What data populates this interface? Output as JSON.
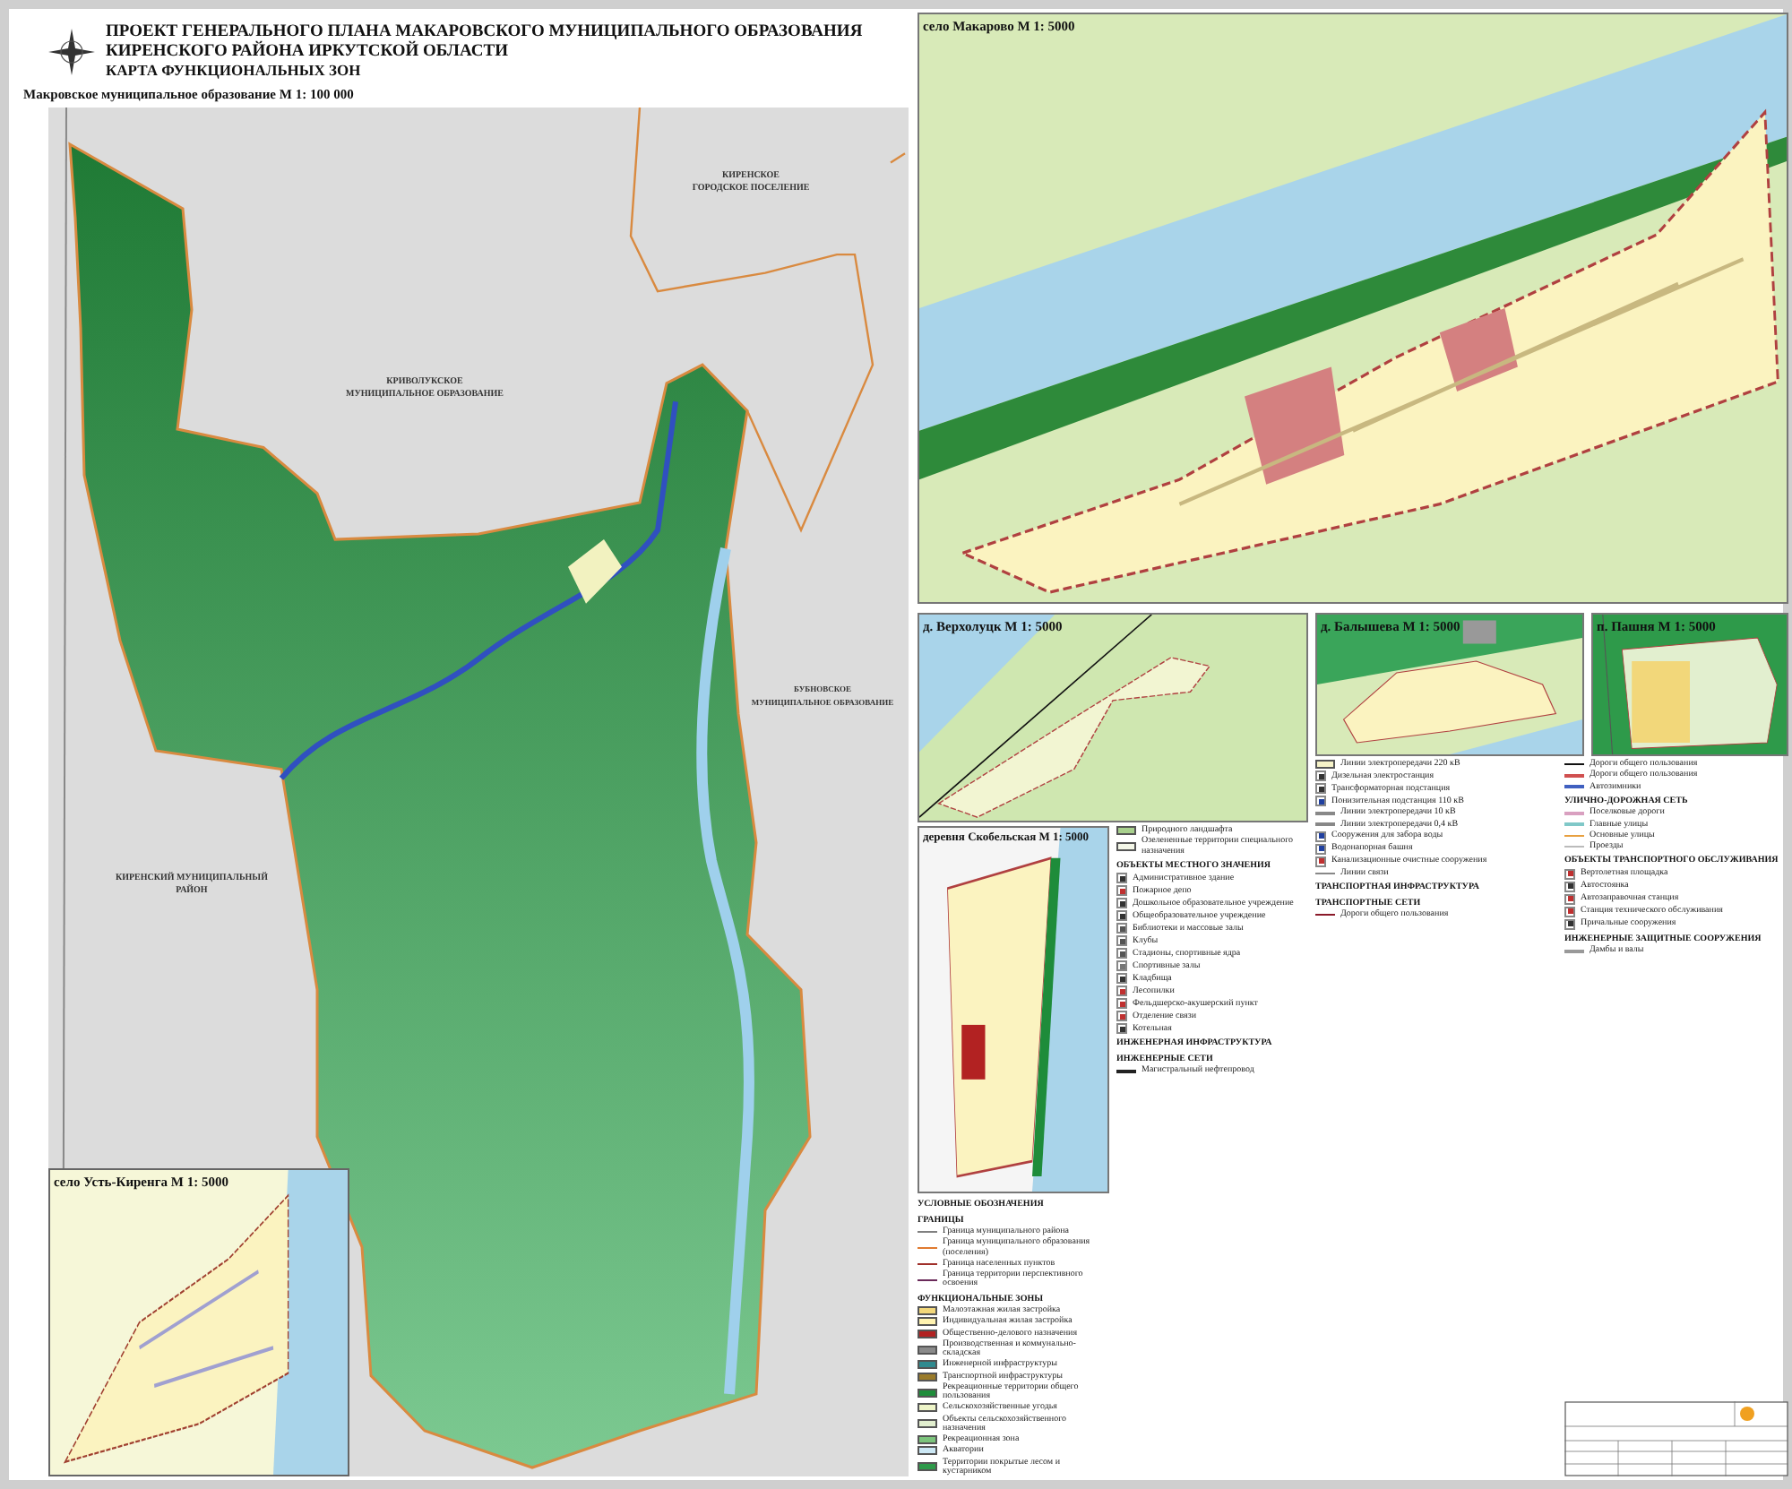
{
  "title": {
    "lines": [
      "ПРОЕКТ ГЕНЕРАЛЬНОГО ПЛАНА МАКАРОВСКОГО МУНИЦИПАЛЬНОГО ОБРАЗОВАНИЯ",
      "КИРЕНСКОГО РАЙОНА ИРКУТСКОЙ ОБЛАСТИ",
      "КАРТА ФУНКЦИОНАЛЬНЫХ ЗОН"
    ]
  },
  "main_map": {
    "caption": "Макровское муниципальное образование М 1: 100 000",
    "labels": [
      {
        "lines": [
          "КИРЕНСКОЕ",
          "ГОРОДСКОЕ ПОСЕЛЕНИЕ"
        ]
      },
      {
        "lines": [
          "КРИВОЛУКСКОЕ",
          "МУНИЦИПАЛЬНОЕ ОБРАЗОВАНИЕ"
        ]
      },
      {
        "lines": [
          "БУБНОВСКОЕ",
          "МУНИЦИПАЛЬНОЕ ОБРАЗОВАНИЕ"
        ]
      },
      {
        "lines": [
          "КИРЕНСКИЙ МУНИЦИПАЛЬНЫЙ",
          "РАЙОН"
        ]
      }
    ]
  },
  "insets": [
    {
      "caption": "село Макарово М 1: 5000"
    },
    {
      "caption": "д. Верхолуцк М 1: 5000"
    },
    {
      "caption": "д. Балышева М 1: 5000"
    },
    {
      "caption": "п. Пашня М 1: 5000"
    },
    {
      "caption": "деревня Скобельская М 1: 5000"
    },
    {
      "caption": "село Усть-Киренга М 1: 5000"
    }
  ],
  "legend": {
    "columns": [
      [
        {
          "kind": "heading",
          "label": "УСЛОВНЫЕ ОБОЗНАЧЕНИЯ"
        },
        {
          "kind": "heading",
          "label": "ГРАНИЦЫ"
        },
        {
          "kind": "line",
          "label": "Граница муниципального района",
          "color": "#808080"
        },
        {
          "kind": "line",
          "label": "Граница муниципального образования (поселения)",
          "color": "#e07a30"
        },
        {
          "kind": "line",
          "label": "Граница населенных пунктов",
          "color": "#a0302a"
        },
        {
          "kind": "line",
          "label": "Граница территории перспективного освоения",
          "color": "#6a2a5a"
        },
        {
          "kind": "heading",
          "label": "ФУНКЦИОНАЛЬНЫЕ ЗОНЫ"
        },
        {
          "kind": "fill",
          "label": "Малоэтажная жилая застройка",
          "color": "#f2d77a"
        },
        {
          "kind": "fill",
          "label": "Индивидуальная жилая застройка",
          "color": "#fff3b0"
        },
        {
          "kind": "fill",
          "label": "Общественно-делового назначения",
          "color": "#b22222"
        },
        {
          "kind": "fill",
          "label": "Производственная и коммунально-складская",
          "color": "#8a8a8a"
        },
        {
          "kind": "fill",
          "label": "Инженерной инфраструктуры",
          "color": "#2f8a8f"
        },
        {
          "kind": "fill",
          "label": "Транспортной инфраструктуры",
          "color": "#9a7b2a"
        },
        {
          "kind": "fill",
          "label": "Рекреационные территории общего пользования",
          "color": "#1e8c3a"
        },
        {
          "kind": "fill",
          "label": "Сельскохозяйственные угодья",
          "color": "#eef5c8"
        },
        {
          "kind": "fill",
          "label": "Объекты сельскохозяйственного назначения",
          "color": "#e2efcf"
        },
        {
          "kind": "fill",
          "label": "Рекреационная зона",
          "color": "#7cc47c"
        },
        {
          "kind": "fill",
          "label": "Акватории",
          "color": "#cce8f5"
        },
        {
          "kind": "fill",
          "label": "Территории покрытые лесом и кустарником",
          "color": "#2e9a4a"
        }
      ],
      [
        {
          "kind": "fill",
          "label": "Природного ландшафта",
          "color": "#a8d08d"
        },
        {
          "kind": "fill",
          "label": "Озелененные территории специального назначения",
          "color": "#f4f7e8"
        },
        {
          "kind": "heading",
          "label": "ОБЪЕКТЫ МЕСТНОГО ЗНАЧЕНИЯ"
        },
        {
          "kind": "symbol",
          "label": "Административное здание",
          "color": "#333333"
        },
        {
          "kind": "symbol",
          "label": "Пожарное депо",
          "color": "#c03030"
        },
        {
          "kind": "symbol",
          "label": "Дошкольное образовательное учреждение",
          "color": "#333333"
        },
        {
          "kind": "symbol",
          "label": "Общеобразовательное учреждение",
          "color": "#333333"
        },
        {
          "kind": "symbol",
          "label": "Библиотеки и массовые залы",
          "color": "#555555"
        },
        {
          "kind": "symbol",
          "label": "Клубы",
          "color": "#555555"
        },
        {
          "kind": "symbol",
          "label": "Стадионы, спортивные ядра",
          "color": "#555555"
        },
        {
          "kind": "symbol",
          "label": "Спортивные залы",
          "color": "#777777"
        },
        {
          "kind": "symbol",
          "label": "Кладбища",
          "color": "#333333"
        },
        {
          "kind": "symbol",
          "label": "Лесопилки",
          "color": "#c03030"
        },
        {
          "kind": "symbol",
          "label": "Фельдшерско-акушерский пункт",
          "color": "#c03030"
        },
        {
          "kind": "symbol",
          "label": "Отделение связи",
          "color": "#c03030"
        },
        {
          "kind": "symbol",
          "label": "Котельная",
          "color": "#333333"
        },
        {
          "kind": "heading",
          "label": "ИНЖЕНЕРНАЯ ИНФРАСТРУКТУРА"
        },
        {
          "kind": "heading",
          "label": "ИНЖЕНЕРНЫЕ СЕТИ"
        },
        {
          "kind": "line",
          "label": "Магистральный нефтепровод",
          "color": "#222222"
        }
      ],
      [
        {
          "kind": "fill",
          "label": "Линии электропередачи 220 кВ",
          "color": "#f6f3c8"
        },
        {
          "kind": "symbol",
          "label": "Дизельная электростанция",
          "color": "#333333"
        },
        {
          "kind": "symbol",
          "label": "Трансформаторная подстанция",
          "color": "#333333"
        },
        {
          "kind": "symbol",
          "label": "Понизительная подстанция 110 кВ",
          "color": "#2040a0"
        },
        {
          "kind": "line",
          "label": "Линии электропередачи 10 кВ",
          "color": "#888888"
        },
        {
          "kind": "line",
          "label": "Линии электропередачи 0,4 кВ",
          "color": "#888888"
        },
        {
          "kind": "symbol",
          "label": "Сооружения для забора воды",
          "color": "#2040a0"
        },
        {
          "kind": "symbol",
          "label": "Водонапорная башня",
          "color": "#2040a0"
        },
        {
          "kind": "symbol",
          "label": "Канализационные очистные сооружения",
          "color": "#c03030"
        },
        {
          "kind": "line",
          "label": "Линии связи",
          "color": "#888888"
        },
        {
          "kind": "heading",
          "label": "ТРАНСПОРТНАЯ ИНФРАСТРУКТУРА"
        },
        {
          "kind": "heading",
          "label": "ТРАНСПОРТНЫЕ СЕТИ"
        },
        {
          "kind": "line",
          "label": "Дороги общего пользования",
          "color": "#8a1a2a"
        }
      ],
      [
        {
          "kind": "line",
          "label": "Дороги общего пользования",
          "color": "#111111"
        },
        {
          "kind": "line",
          "label": "Дороги общего пользования",
          "color": "#d05050"
        },
        {
          "kind": "line",
          "label": "Автозимники",
          "color": "#4060c0"
        },
        {
          "kind": "heading",
          "label": "УЛИЧНО-ДОРОЖНАЯ СЕТЬ"
        },
        {
          "kind": "line",
          "label": "Поселковые дороги",
          "color": "#d9a0c0"
        },
        {
          "kind": "line",
          "label": "Главные улицы",
          "color": "#80c8c8"
        },
        {
          "kind": "line",
          "label": "Основные улицы",
          "color": "#e8a040"
        },
        {
          "kind": "line",
          "label": "Проезды",
          "color": "#bbbbbb"
        },
        {
          "kind": "heading",
          "label": "ОБЪЕКТЫ ТРАНСПОРТНОГО ОБСЛУЖИВАНИЯ"
        },
        {
          "kind": "symbol",
          "label": "Вертолетная площадка",
          "color": "#c03030"
        },
        {
          "kind": "symbol",
          "label": "Автостоянка",
          "color": "#333333"
        },
        {
          "kind": "symbol",
          "label": "Автозаправочная станция",
          "color": "#c03030"
        },
        {
          "kind": "symbol",
          "label": "Станция технического обслуживания",
          "color": "#c03030"
        },
        {
          "kind": "symbol",
          "label": "Причальные сооружения",
          "color": "#333333"
        },
        {
          "kind": "heading",
          "label": "ИНЖЕНЕРНЫЕ ЗАЩИТНЫЕ СООРУЖЕНИЯ"
        },
        {
          "kind": "line",
          "label": "Дамбы и валы",
          "color": "#999999"
        }
      ]
    ]
  }
}
